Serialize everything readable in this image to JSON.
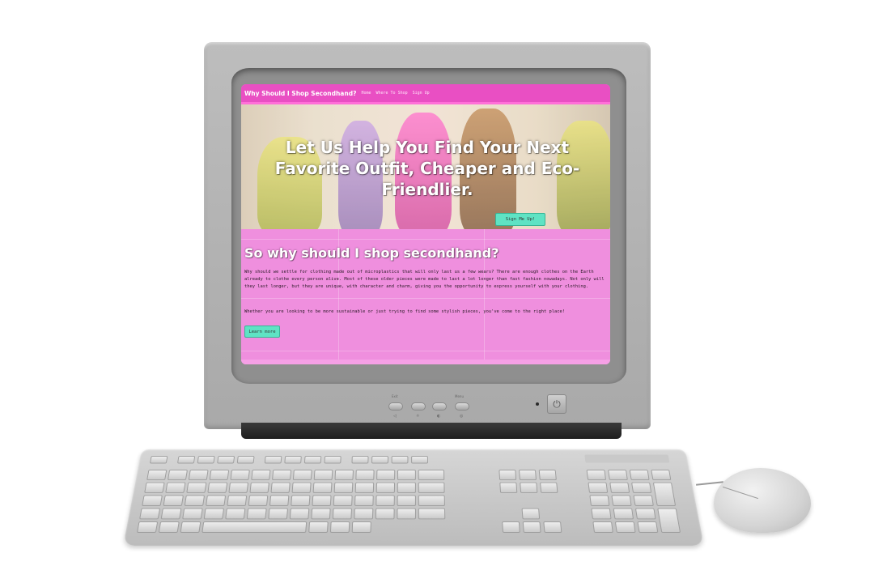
{
  "site": {
    "brand": "Why Should I Shop Secondhand?",
    "nav": [
      "Home",
      "Where To Shop",
      "Sign Up"
    ],
    "hero_title": "Let Us Help You Find Your Next Favorite Outfit, Cheaper and Eco-Friendlier.",
    "signup_button": "Sign Me Up!",
    "section_heading": "So why should I shop secondhand?",
    "paragraph_1": "Why should we settle for clothing made out of microplastics that will only last us a few wears? There are enough clothes on the Earth already to clothe every person alive. Most of these older pieces were made to last a lot longer than fast fashion nowadays. Not only will they last longer, but they are unique, with character and charm, giving you the opportunity to express yourself with your clothing.",
    "paragraph_2": "Whether you are looking to be more sustainable or just trying to find some stylish pieces, you've come to the right place!",
    "learn_button": "Learn more"
  },
  "monitor": {
    "control_labels": [
      "Exit",
      "Menu"
    ],
    "control_symbols": [
      "◁",
      "☼",
      "◐",
      "◎"
    ],
    "power_symbol": "⏻"
  },
  "colors": {
    "nav_bg": "#e94fc3",
    "content_bg": "#ef8fde",
    "button_bg": "#5fe3c4",
    "bezel": "#b8b8b8"
  }
}
